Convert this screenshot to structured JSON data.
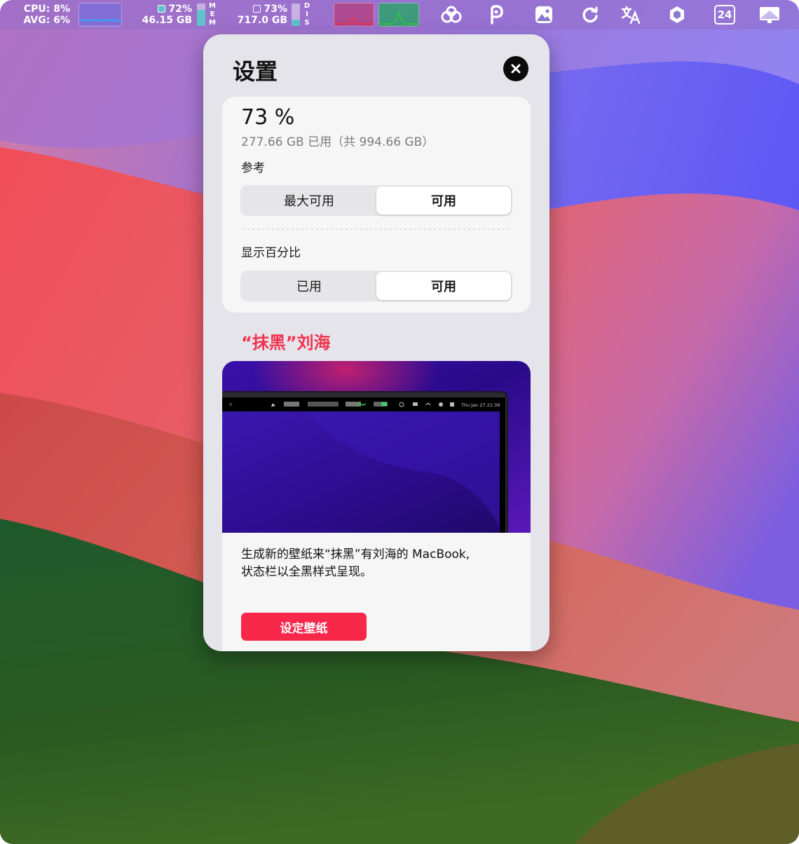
{
  "menubar": {
    "cpu": {
      "line1": "CPU: 8%",
      "line2": "AVG: 6%"
    },
    "memory": {
      "percent": "72%",
      "size": "46.15 GB",
      "letters": [
        "M",
        "E",
        "M"
      ],
      "fill_fraction": 0.72
    },
    "disk": {
      "percent": "73%",
      "size": "717.0 GB",
      "letters": [
        "D",
        "I",
        "S"
      ],
      "fill_fraction": 0.27
    },
    "icons": [
      "cloud-sync-icon",
      "p-app-icon",
      "photo-icon",
      "refresh-icon",
      "translate-icon",
      "hexagon-icon",
      "calendar-icon",
      "display-icon"
    ],
    "calendar_day": "24",
    "colors": {
      "cpu_graph": "#2fa8ff",
      "net_down": "#e8304a",
      "net_up": "#2fc14a"
    }
  },
  "panel": {
    "title": "设置",
    "disk": {
      "percent": "73 %",
      "usage": "277.66 GB 已用（共 994.66 GB）"
    },
    "reference": {
      "label": "参考",
      "options": [
        "最大可用",
        "可用"
      ],
      "selected": "可用"
    },
    "display_percent": {
      "label": "显示百分比",
      "options": [
        "已用",
        "可用"
      ],
      "selected": "可用"
    },
    "notch": {
      "heading": "“抹黑”刘海",
      "description_line1": "生成新的壁纸来“抹黑”有刘海的 MacBook,",
      "description_line2": "状态栏以全黑样式呈现。",
      "button": "设定壁纸",
      "preview_clock": "Thu Jan 27  21:39"
    },
    "colors": {
      "accent": "#f0334f",
      "button": "#f7284a"
    }
  }
}
